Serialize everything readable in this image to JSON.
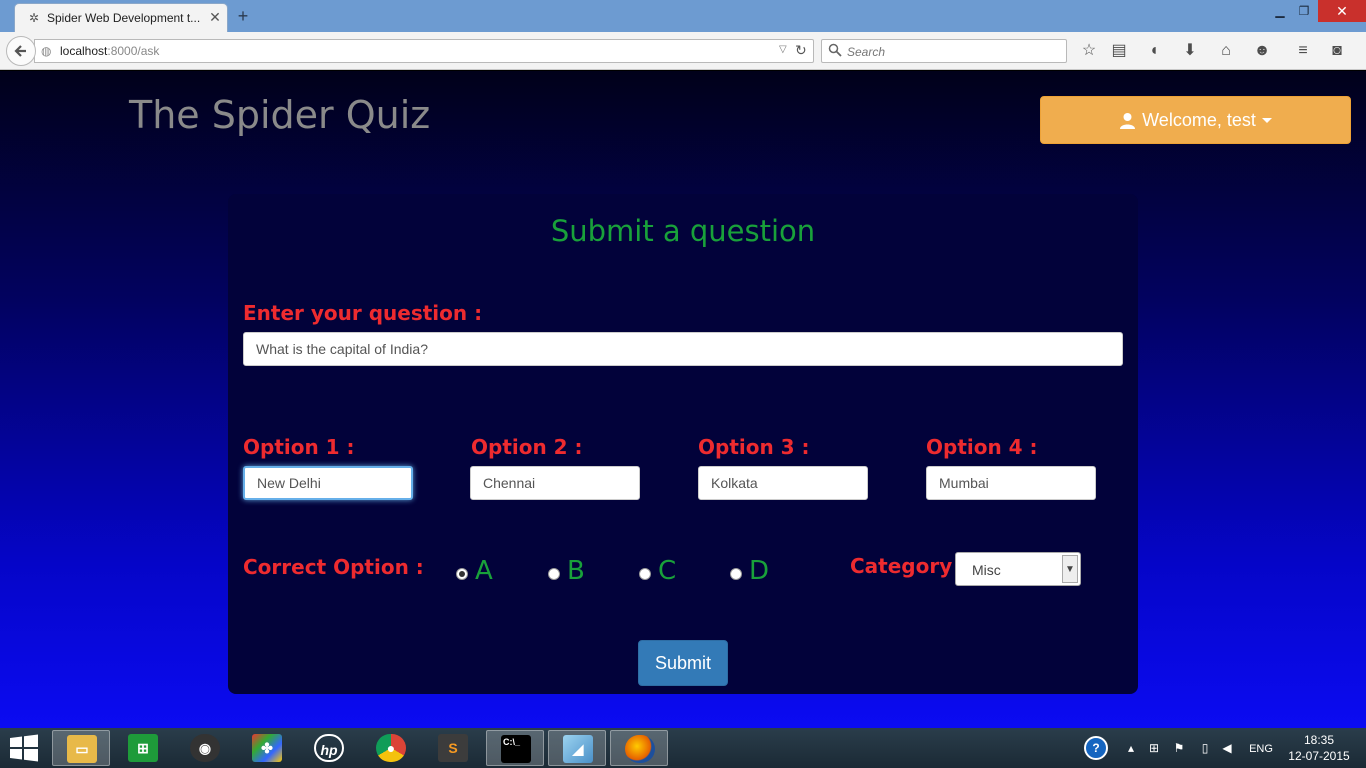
{
  "browser": {
    "tab_title": "Spider Web Development t...",
    "new_tab_label": "+",
    "url_host": "localhost",
    "url_rest": ":8000/ask",
    "search_placeholder": "Search"
  },
  "header": {
    "brand": "The Spider Quiz",
    "welcome": "Welcome, test"
  },
  "form": {
    "title": "Submit a question",
    "question_label": "Enter your question :",
    "question_value": "What is the capital of India?",
    "options": [
      {
        "label": "Option 1 :",
        "value": "New Delhi"
      },
      {
        "label": "Option 2 :",
        "value": "Chennai"
      },
      {
        "label": "Option 3 :",
        "value": "Kolkata"
      },
      {
        "label": "Option 4 :",
        "value": "Mumbai"
      }
    ],
    "correct_label": "Correct Option :",
    "correct_choices": [
      "A",
      "B",
      "C",
      "D"
    ],
    "correct_selected": "A",
    "category_label": "Category :",
    "category_value": "Misc",
    "submit_label": "Submit"
  },
  "taskbar": {
    "language": "ENG",
    "time": "18:35",
    "date": "12-07-2015"
  },
  "colors": {
    "label_red": "#ee2b2f",
    "title_green": "#19a13a",
    "welcome_orange": "#f0ad4e",
    "submit_blue": "#337ab7"
  }
}
